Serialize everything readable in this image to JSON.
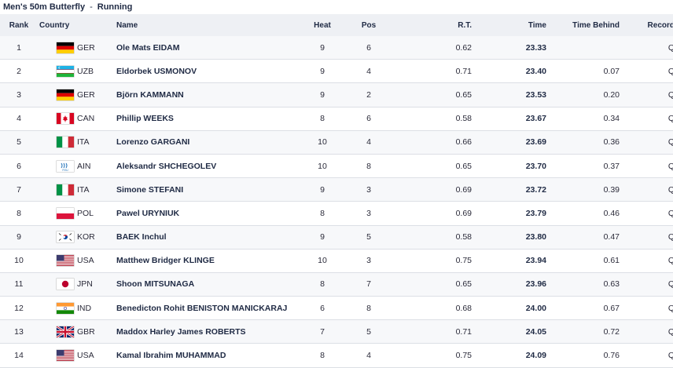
{
  "header": {
    "event": "Men's 50m Butterfly",
    "separator": "-",
    "status": "Running"
  },
  "columns": [
    "Rank",
    "Country",
    "Name",
    "Heat",
    "Pos",
    "R.T.",
    "Time",
    "Time Behind",
    "Record"
  ],
  "rows": [
    {
      "rank": "1",
      "flag": "ger",
      "code": "GER",
      "name": "Ole Mats EIDAM",
      "heat": "9",
      "pos": "6",
      "rt": "0.62",
      "time": "23.33",
      "behind": "",
      "record": "Q"
    },
    {
      "rank": "2",
      "flag": "uzb",
      "code": "UZB",
      "name": "Eldorbek USMONOV",
      "heat": "9",
      "pos": "4",
      "rt": "0.71",
      "time": "23.40",
      "behind": "0.07",
      "record": "Q"
    },
    {
      "rank": "3",
      "flag": "ger",
      "code": "GER",
      "name": "Björn KAMMANN",
      "heat": "9",
      "pos": "2",
      "rt": "0.65",
      "time": "23.53",
      "behind": "0.20",
      "record": "Q"
    },
    {
      "rank": "4",
      "flag": "can",
      "code": "CAN",
      "name": "Phillip WEEKS",
      "heat": "8",
      "pos": "6",
      "rt": "0.58",
      "time": "23.67",
      "behind": "0.34",
      "record": "Q"
    },
    {
      "rank": "5",
      "flag": "ita",
      "code": "ITA",
      "name": "Lorenzo GARGANI",
      "heat": "10",
      "pos": "4",
      "rt": "0.66",
      "time": "23.69",
      "behind": "0.36",
      "record": "Q"
    },
    {
      "rank": "6",
      "flag": "ain",
      "code": "AIN",
      "name": "Aleksandr SHCHEGOLEV",
      "heat": "10",
      "pos": "8",
      "rt": "0.65",
      "time": "23.70",
      "behind": "0.37",
      "record": "Q"
    },
    {
      "rank": "7",
      "flag": "ita",
      "code": "ITA",
      "name": "Simone STEFANI",
      "heat": "9",
      "pos": "3",
      "rt": "0.69",
      "time": "23.72",
      "behind": "0.39",
      "record": "Q"
    },
    {
      "rank": "8",
      "flag": "pol",
      "code": "POL",
      "name": "Pawel URYNIUK",
      "heat": "8",
      "pos": "3",
      "rt": "0.69",
      "time": "23.79",
      "behind": "0.46",
      "record": "Q"
    },
    {
      "rank": "9",
      "flag": "kor",
      "code": "KOR",
      "name": "BAEK Inchul",
      "heat": "9",
      "pos": "5",
      "rt": "0.58",
      "time": "23.80",
      "behind": "0.47",
      "record": "Q"
    },
    {
      "rank": "10",
      "flag": "usa",
      "code": "USA",
      "name": "Matthew Bridger KLINGE",
      "heat": "10",
      "pos": "3",
      "rt": "0.75",
      "time": "23.94",
      "behind": "0.61",
      "record": "Q"
    },
    {
      "rank": "11",
      "flag": "jpn",
      "code": "JPN",
      "name": "Shoon MITSUNAGA",
      "heat": "8",
      "pos": "7",
      "rt": "0.65",
      "time": "23.96",
      "behind": "0.63",
      "record": "Q"
    },
    {
      "rank": "12",
      "flag": "ind",
      "code": "IND",
      "name": "Benedicton Rohit BENISTON MANICKARAJ",
      "heat": "6",
      "pos": "8",
      "rt": "0.68",
      "time": "24.00",
      "behind": "0.67",
      "record": "Q"
    },
    {
      "rank": "13",
      "flag": "gbr",
      "code": "GBR",
      "name": "Maddox Harley James ROBERTS",
      "heat": "7",
      "pos": "5",
      "rt": "0.71",
      "time": "24.05",
      "behind": "0.72",
      "record": "Q"
    },
    {
      "rank": "14",
      "flag": "usa",
      "code": "USA",
      "name": "Kamal Ibrahim MUHAMMAD",
      "heat": "8",
      "pos": "4",
      "rt": "0.75",
      "time": "24.09",
      "behind": "0.76",
      "record": "Q"
    }
  ],
  "colors": {
    "header_bg": "#eef0f4",
    "row_alt": "#f7f8fa",
    "text_dark": "#1f2a44",
    "divider": "#dcdfe5"
  }
}
